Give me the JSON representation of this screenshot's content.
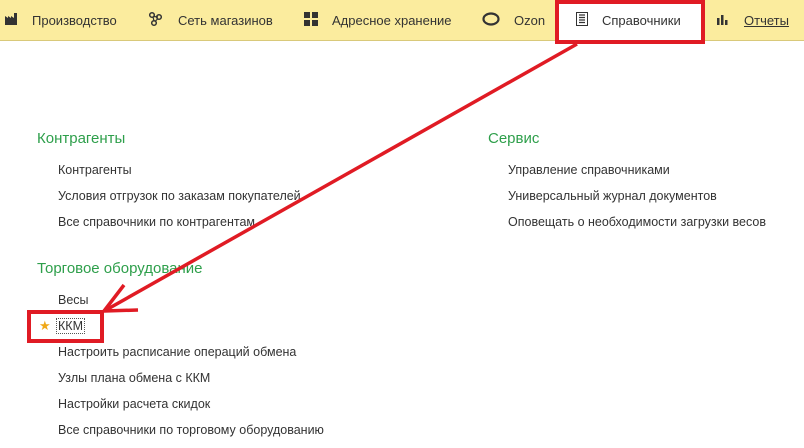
{
  "topbar": {
    "tabs": [
      {
        "label": "Производство",
        "icon": "factory-icon"
      },
      {
        "label": "Сеть магазинов",
        "icon": "network-icon"
      },
      {
        "label": "Адресное хранение",
        "icon": "grid-icon"
      },
      {
        "label": "Ozon",
        "icon": "ozon-icon"
      },
      {
        "label": "Справочники",
        "icon": "directory-icon",
        "active": true
      },
      {
        "label": "Отчеты",
        "icon": "bar-chart-icon"
      }
    ]
  },
  "sections": {
    "counterparties": {
      "title": "Контрагенты",
      "items": [
        "Контрагенты",
        "Условия отгрузок по заказам покупателей",
        "Все справочники по контрагентам"
      ]
    },
    "service": {
      "title": "Сервис",
      "items": [
        "Управление справочниками",
        "Универсальный журнал документов",
        "Оповещать о необходимости загрузки весов"
      ]
    },
    "equipment": {
      "title": "Торговое оборудование",
      "items": [
        "Весы",
        "ККМ",
        "Настроить расписание операций обмена",
        "Узлы плана обмена с ККМ",
        "Настройки расчета скидок",
        "Все справочники по торговому оборудованию"
      ]
    }
  },
  "colors": {
    "accent_green": "#2e9f4b",
    "topbar_bg": "#fbec9e",
    "annotation_red": "#e01b24",
    "star": "#f0a818"
  }
}
